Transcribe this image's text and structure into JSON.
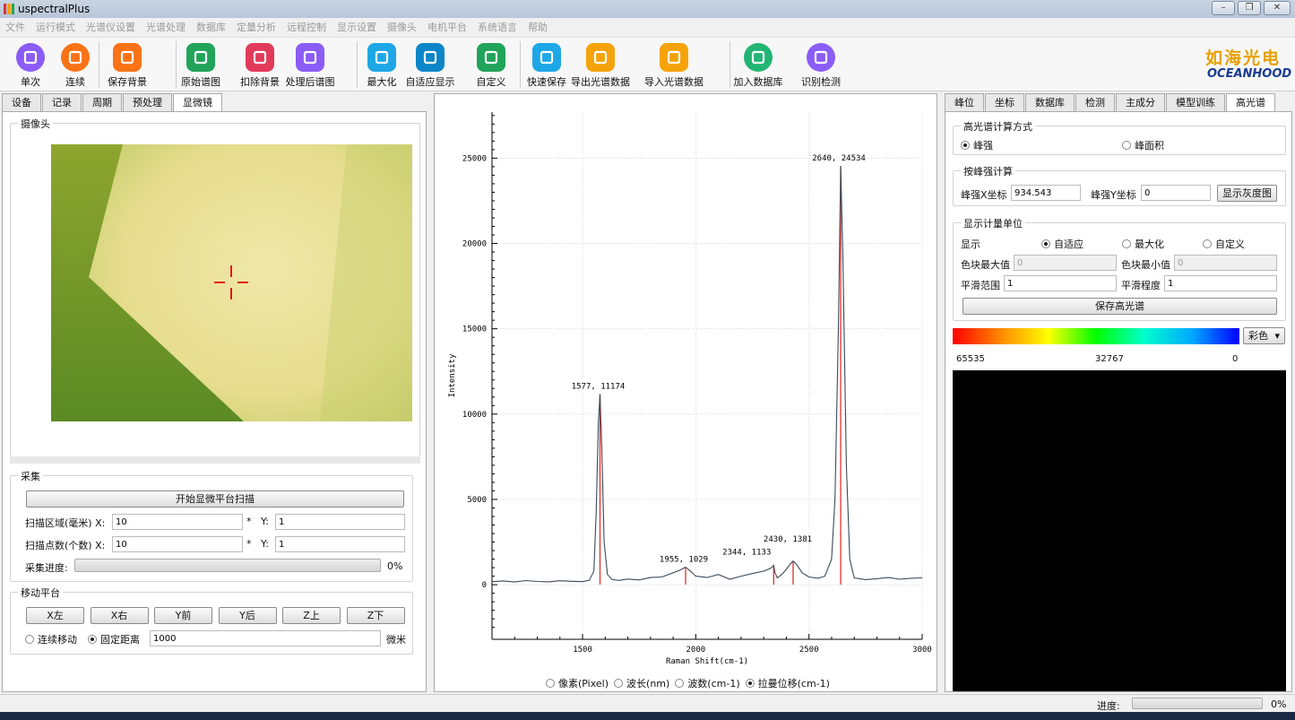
{
  "window": {
    "title": "uspectralPlus",
    "buttons": [
      "–",
      "❐",
      "✕"
    ]
  },
  "menu": [
    "文件",
    "运行模式",
    "光谱仪设置",
    "光谱处理",
    "数据库",
    "定量分析",
    "远程控制",
    "显示设置",
    "摄像头",
    "电机平台",
    "系统语言",
    "帮助"
  ],
  "toolbar": {
    "items": [
      {
        "label": "单次",
        "icon": "single-shot-icon",
        "color": "#8b5cf6"
      },
      {
        "label": "连续",
        "icon": "continuous-icon",
        "color": "#f97316"
      },
      {
        "label": "保存背景",
        "icon": "save-background-icon",
        "color": "#f97316"
      },
      {
        "label": "原始谱图",
        "icon": "raw-spectrum-icon",
        "color": "#22a35a"
      },
      {
        "label": "扣除背景",
        "icon": "subtract-background-icon",
        "color": "#e23a5a"
      },
      {
        "label": "处理后谱图",
        "icon": "processed-spectrum-icon",
        "color": "#8b5cf6"
      },
      {
        "label": "最大化",
        "icon": "maximize-icon",
        "color": "#1ea7e6"
      },
      {
        "label": "自适应显示",
        "icon": "auto-fit-icon",
        "color": "#0b86c8"
      },
      {
        "label": "自定义",
        "icon": "custom-layout-icon",
        "color": "#22a35a"
      },
      {
        "label": "快速保存",
        "icon": "quick-save-icon",
        "color": "#1ea7e6"
      },
      {
        "label": "导出光谱数据",
        "icon": "export-folder-icon",
        "color": "#f5a30a"
      },
      {
        "label": "导入光谱数据",
        "icon": "import-folder-icon",
        "color": "#f5a30a"
      },
      {
        "label": "加入数据库",
        "icon": "add-database-icon",
        "color": "#22b573"
      },
      {
        "label": "识别检测",
        "icon": "identify-icon",
        "color": "#8b5cf6"
      }
    ],
    "logo_cn": "如海光电",
    "logo_en": "OCEANHOOD"
  },
  "left": {
    "tabs": [
      "设备",
      "记录",
      "周期",
      "预处理",
      "显微镜"
    ],
    "active_tab": 4,
    "camera": {
      "title": "摄像头"
    },
    "acquire": {
      "title": "采集",
      "scan_button": "开始显微平台扫描",
      "area_label": "扫描区域(毫米) X:",
      "area_x": "10",
      "star": "*",
      "y_label": "Y:",
      "area_y": "1",
      "points_label": "扫描点数(个数) X:",
      "points_x": "10",
      "points_y": "1",
      "progress_label": "采集进度:",
      "progress_text": "0%",
      "progress_value": 0
    },
    "stage": {
      "title": "移动平台",
      "buttons": [
        "X左",
        "X右",
        "Y前",
        "Y后",
        "Z上",
        "Z下"
      ],
      "continuous": "连续移动",
      "fixed": "固定距离",
      "distance": "1000",
      "unit": "微米"
    }
  },
  "chart_data": {
    "type": "line",
    "xlabel": "Raman Shift(cm-1)",
    "ylabel": "Intensity",
    "xlim": [
      1100,
      3000
    ],
    "ylim": [
      -3200,
      27700
    ],
    "xticks": [
      1500,
      2000,
      2500,
      3000
    ],
    "yticks": [
      0,
      5000,
      10000,
      15000,
      20000,
      25000
    ],
    "grid": true,
    "series": [
      {
        "x": [
          1100,
          1150,
          1200,
          1250,
          1300,
          1350,
          1400,
          1450,
          1500,
          1530,
          1550,
          1560,
          1570,
          1577,
          1585,
          1595,
          1610,
          1630,
          1660,
          1700,
          1750,
          1800,
          1850,
          1900,
          1930,
          1955,
          1980,
          2000,
          2050,
          2100,
          2150,
          2200,
          2250,
          2300,
          2330,
          2344,
          2350,
          2360,
          2380,
          2400,
          2420,
          2430,
          2445,
          2470,
          2500,
          2540,
          2570,
          2600,
          2615,
          2630,
          2640,
          2650,
          2665,
          2680,
          2700,
          2750,
          2800,
          2850,
          2900,
          2950,
          3000
        ],
        "y": [
          180,
          220,
          160,
          240,
          190,
          170,
          230,
          200,
          180,
          260,
          800,
          4200,
          9500,
          11174,
          8000,
          2500,
          600,
          300,
          250,
          330,
          280,
          420,
          450,
          700,
          850,
          1029,
          750,
          500,
          420,
          600,
          320,
          500,
          650,
          800,
          950,
          1133,
          700,
          400,
          600,
          900,
          1250,
          1381,
          1200,
          700,
          450,
          380,
          500,
          1500,
          5000,
          15000,
          24534,
          19000,
          7000,
          1500,
          400,
          300,
          350,
          420,
          320,
          380,
          400
        ]
      }
    ],
    "peaks": [
      {
        "x": 1577,
        "y": 11174,
        "label": "1577, 11174"
      },
      {
        "x": 1955,
        "y": 1029,
        "label": "1955, 1029"
      },
      {
        "x": 2344,
        "y": 1133,
        "label": "2344, 1133"
      },
      {
        "x": 2430,
        "y": 1381,
        "label": "2430, 1381"
      },
      {
        "x": 2640,
        "y": 24534,
        "label": "2640, 24534"
      }
    ],
    "line_color": "#3b4a58",
    "peak_color": "#e03030"
  },
  "xaxis_modes": [
    {
      "label": "像素(Pixel)",
      "checked": false
    },
    {
      "label": "波长(nm)",
      "checked": false
    },
    {
      "label": "波数(cm-1)",
      "checked": false
    },
    {
      "label": "拉曼位移(cm-1)",
      "checked": true
    }
  ],
  "right": {
    "tabs": [
      "峰位",
      "坐标",
      "数据库",
      "检测",
      "主成分",
      "模型训练",
      "高光谱"
    ],
    "active_tab": 6,
    "calc": {
      "title": "高光谱计算方式",
      "opt1": "峰强",
      "opt2": "峰面积"
    },
    "peak": {
      "title": "按峰强计算",
      "x_label": "峰强X坐标",
      "x_value": "934.543",
      "y_label": "峰强Y坐标",
      "y_value": "0",
      "button": "显示灰度图"
    },
    "unit": {
      "title": "显示计量单位",
      "show": "显示",
      "auto": "自适应",
      "max": "最大化",
      "custom": "自定义",
      "max_label": "色块最大值",
      "max_value": "0",
      "min_label": "色块最小值",
      "min_value": "0",
      "smooth_range_label": "平滑范围",
      "smooth_range": "1",
      "smooth_level_label": "平滑程度",
      "smooth_level": "1",
      "save_button": "保存高光谱"
    },
    "colormap": {
      "select": "彩色",
      "max": "65535",
      "mid": "32767",
      "min": "0"
    }
  },
  "status": {
    "label": "进度:",
    "value": "0%"
  }
}
